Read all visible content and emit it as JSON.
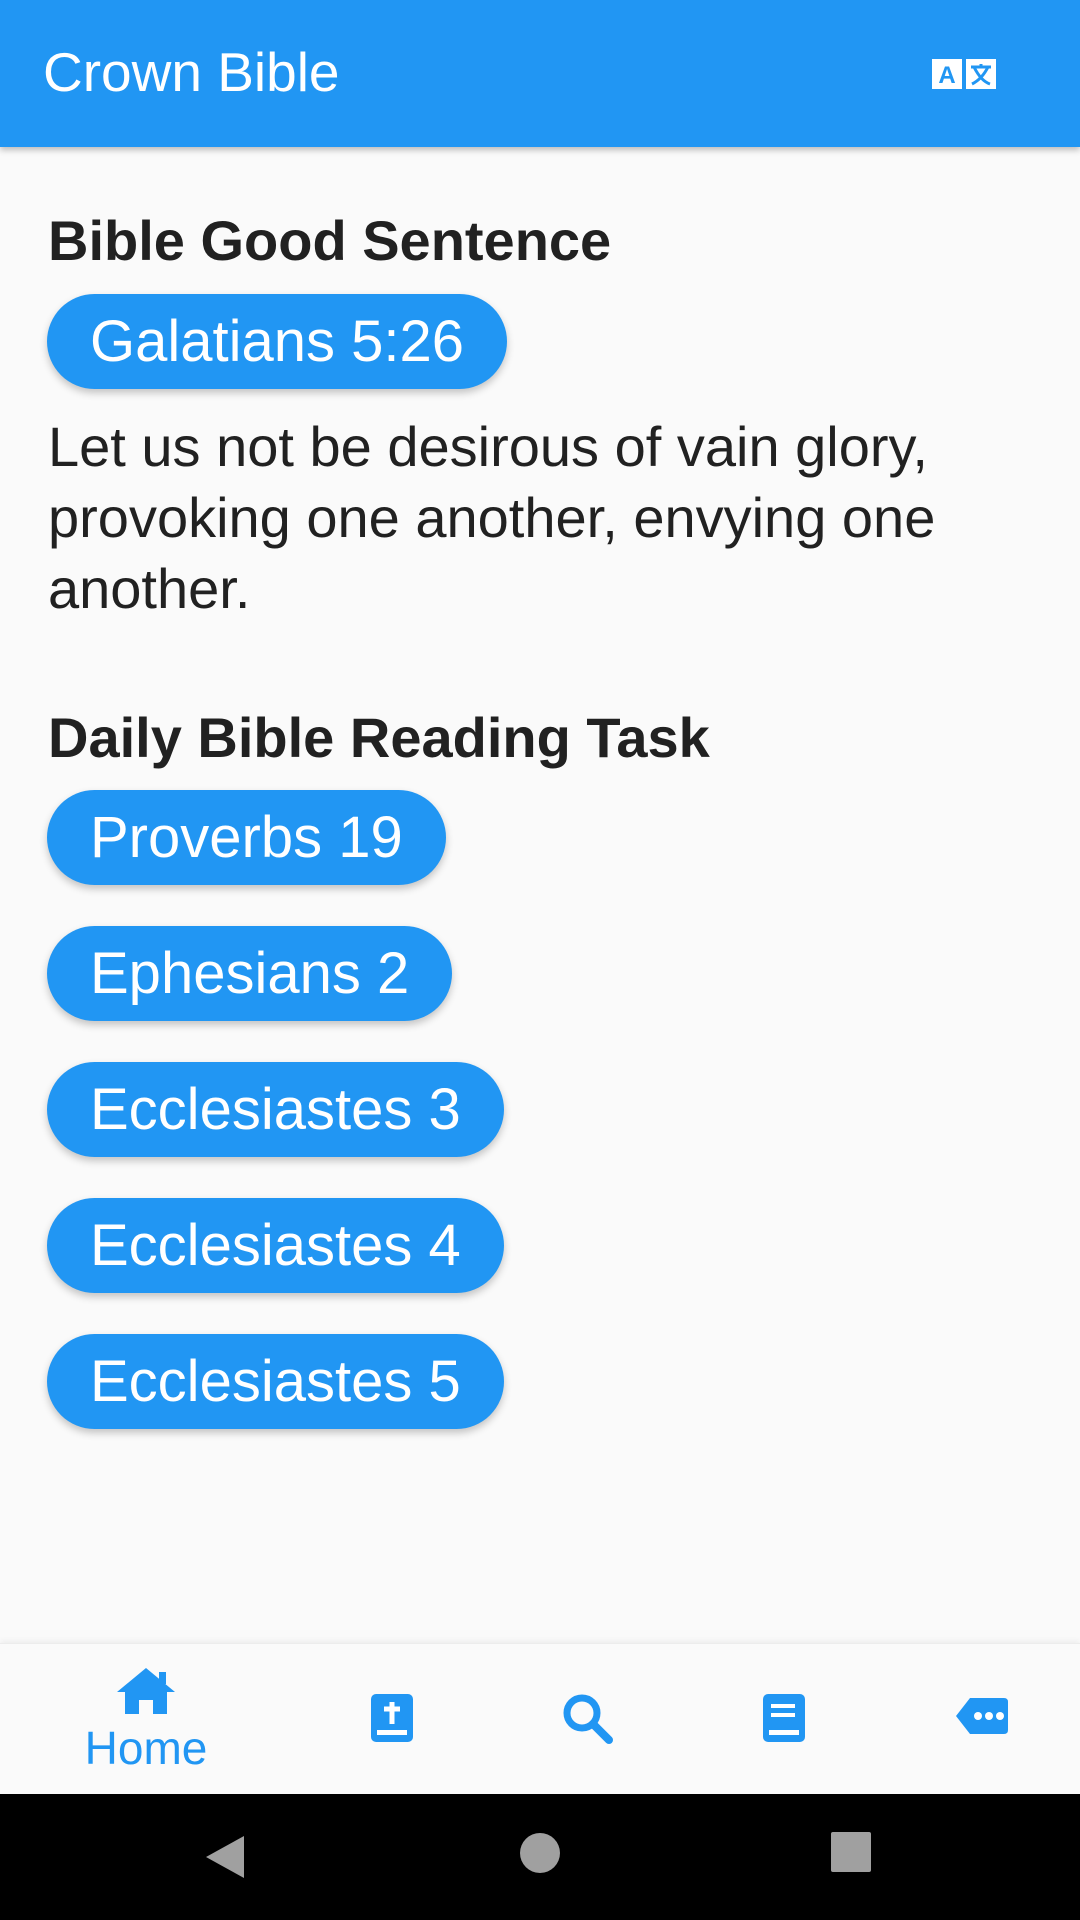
{
  "app_bar": {
    "title": "Crown Bible",
    "translate_icon": "translate-icon"
  },
  "good_sentence": {
    "heading": "Bible Good Sentence",
    "reference": "Galatians 5:26",
    "text": "Let us not be desirous of vain glory, provoking one another, envying one another."
  },
  "reading_task": {
    "heading": "Daily Bible Reading Task",
    "items": [
      {
        "label": "Proverbs 19"
      },
      {
        "label": "Ephesians 2"
      },
      {
        "label": "Ecclesiastes 3"
      },
      {
        "label": "Ecclesiastes 4"
      },
      {
        "label": "Ecclesiastes 5"
      }
    ]
  },
  "bottom_nav": {
    "items": [
      {
        "icon": "home-icon",
        "label": "Home",
        "active": true
      },
      {
        "icon": "bible-icon",
        "label": ""
      },
      {
        "icon": "search-icon",
        "label": ""
      },
      {
        "icon": "book-icon",
        "label": ""
      },
      {
        "icon": "message-icon",
        "label": ""
      }
    ]
  },
  "system_nav": {
    "buttons": [
      "back-icon",
      "home-circle-icon",
      "recents-icon"
    ]
  },
  "colors": {
    "primary": "#2196f3",
    "background": "#fafafa",
    "text": "#212121"
  }
}
